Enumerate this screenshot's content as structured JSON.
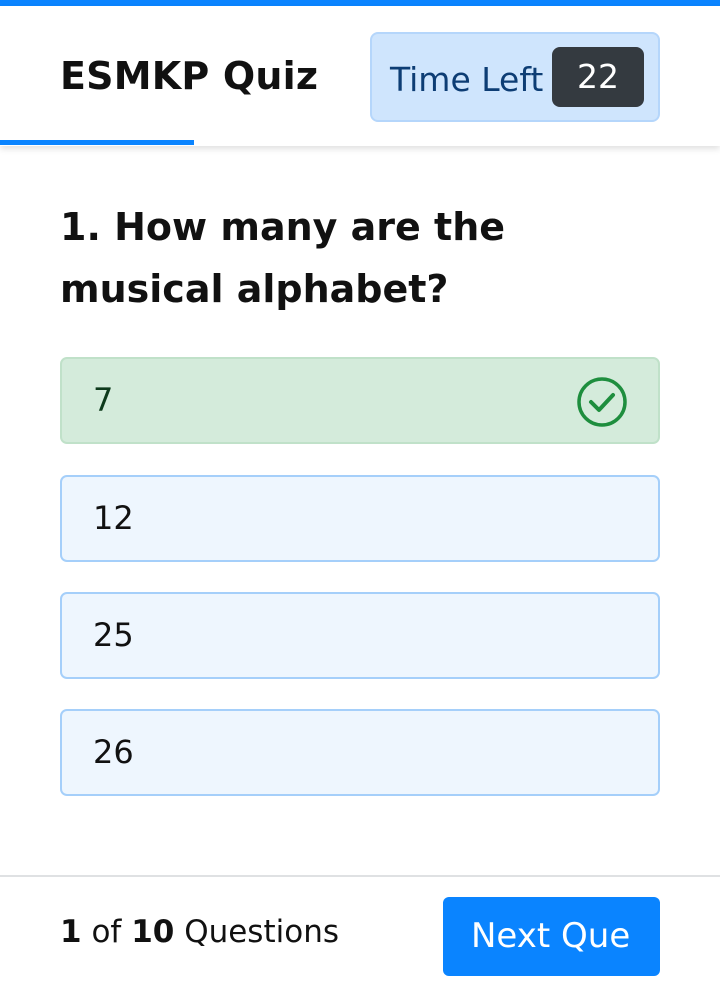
{
  "app": {
    "title": "ESMKP Quiz"
  },
  "timer": {
    "label": "Time Left",
    "value": "22"
  },
  "progress": {
    "current": 1,
    "total": 10,
    "fraction": 0.1
  },
  "question": {
    "text": "1. How many are the musical alphabet?"
  },
  "options": [
    {
      "label": "7",
      "state": "correct"
    },
    {
      "label": "12",
      "state": "default"
    },
    {
      "label": "25",
      "state": "default"
    },
    {
      "label": "26",
      "state": "default"
    }
  ],
  "footer": {
    "current": "1",
    "of": "of",
    "total": "10",
    "suffix": "Questions",
    "next_label": "Next Que"
  },
  "icons": {
    "correct": "check-circle-icon"
  },
  "colors": {
    "accent": "#0a84ff",
    "correct_bg": "#d4ebdb",
    "correct_icon": "#1e8e3e",
    "option_bg": "#eef6fe",
    "timer_bg": "#cfe5fd"
  }
}
